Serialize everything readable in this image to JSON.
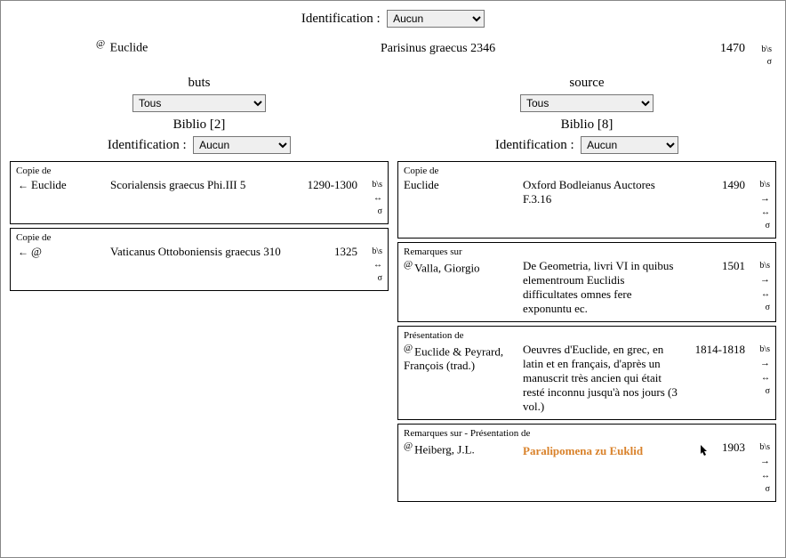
{
  "idLabel": "Identification :",
  "idSelected": "Aucun",
  "main": {
    "author": "Euclide",
    "title": "Parisinus graecus 2346",
    "year": "1470",
    "m1": "b\\s",
    "m2": "σ"
  },
  "left": {
    "heading": "buts",
    "filterSelected": "Tous",
    "biblio": "Biblio [2]",
    "idSelected": "Aucun",
    "cards": [
      {
        "rel": "Copie de",
        "arrow": "←",
        "author": "Euclide",
        "title": "Scorialensis graecus Phi.III 5",
        "year": "1290-1300",
        "marks": {
          "bs": "b\\s",
          "lr": "↔",
          "sigma": "σ"
        }
      },
      {
        "rel": "Copie de",
        "arrow": "←",
        "author": "@",
        "title": "Vaticanus Ottoboniensis graecus 310",
        "year": "1325",
        "marks": {
          "bs": "b\\s",
          "lr": "↔",
          "sigma": "σ"
        }
      }
    ]
  },
  "right": {
    "heading": "source",
    "filterSelected": "Tous",
    "biblio": "Biblio [8]",
    "idSelected": "Aucun",
    "cards": [
      {
        "rel": "Copie de",
        "at": "",
        "author": "Euclide",
        "title": "Oxford Bodleianus Auctores F.3.16",
        "year": "1490",
        "marks": {
          "bs": "b\\s",
          "arrow": "→",
          "lr": "↔",
          "sigma": "σ"
        },
        "highlight": false
      },
      {
        "rel": "Remarques sur",
        "at": "@",
        "author": "Valla, Giorgio",
        "title": "De Geometria, livri VI in quibus elementroum Euclidis difficultates omnes fere exponuntu ec.",
        "year": "1501",
        "marks": {
          "bs": "b\\s",
          "arrow": "→",
          "lr": "↔",
          "sigma": "σ"
        },
        "highlight": false
      },
      {
        "rel": "Présentation de",
        "at": "@",
        "author": "Euclide & Peyrard, François (trad.)",
        "title": "Oeuvres d'Euclide, en grec, en latin et en français, d'après un manuscrit très ancien qui était resté inconnu jusqu'à nos jours (3 vol.)",
        "year": "1814-1818",
        "marks": {
          "bs": "b\\s",
          "arrow": "→",
          "lr": "↔",
          "sigma": "σ"
        },
        "highlight": false
      },
      {
        "rel": "Remarques sur - Présentation de",
        "at": "@",
        "author": "Heiberg, J.L.",
        "title": "Paralipomena zu Euklid",
        "year": "1903",
        "marks": {
          "bs": "b\\s",
          "arrow": "→",
          "lr": "↔",
          "sigma": "σ"
        },
        "highlight": true
      }
    ]
  }
}
